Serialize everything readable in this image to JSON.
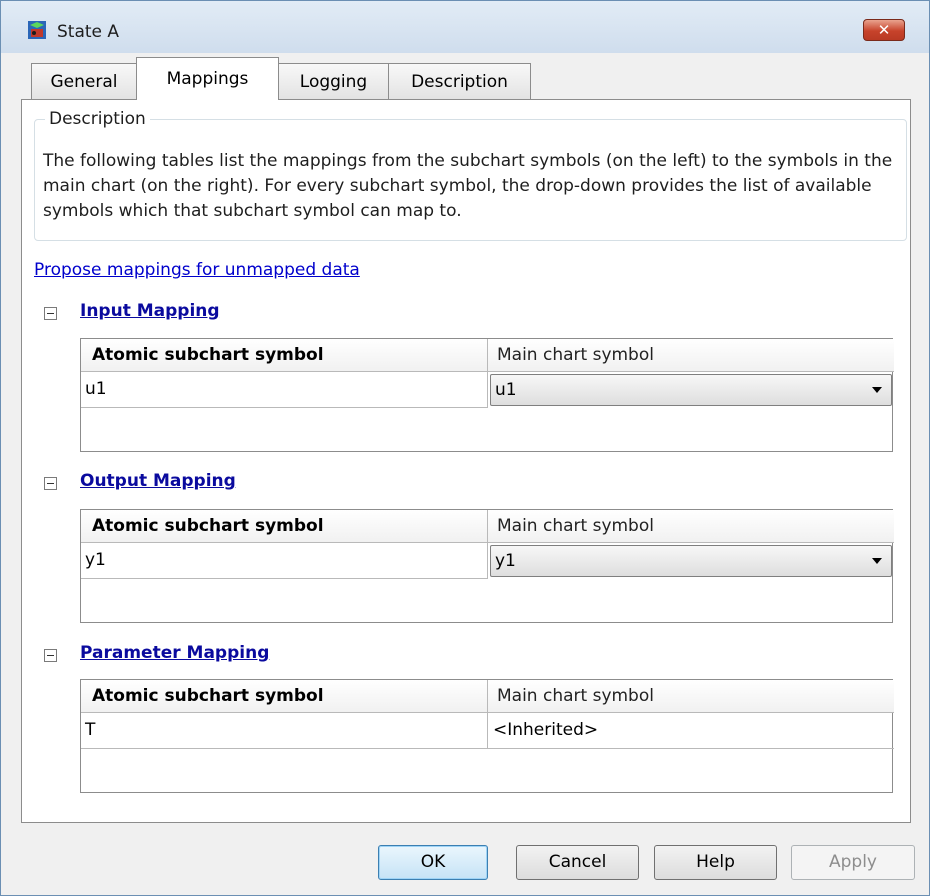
{
  "window": {
    "title": "State A",
    "close_label": "✕"
  },
  "tabs": [
    {
      "label": "General",
      "active": false
    },
    {
      "label": "Mappings",
      "active": true
    },
    {
      "label": "Logging",
      "active": false
    },
    {
      "label": "Description",
      "active": false
    }
  ],
  "description": {
    "legend": "Description",
    "text": "The following tables list the mappings from the subchart symbols (on the left) to the symbols in the main chart (on the right). For every subchart symbol, the drop-down provides the list of available symbols which that subchart symbol can map to."
  },
  "propose_link": "Propose mappings for unmapped data",
  "sections": [
    {
      "title": "Input Mapping",
      "col1_header": "Atomic subchart symbol",
      "col2_header": "Main chart symbol",
      "rows": [
        {
          "symbol": "u1",
          "main": "u1",
          "editable": true
        }
      ]
    },
    {
      "title": "Output Mapping",
      "col1_header": "Atomic subchart symbol",
      "col2_header": "Main chart symbol",
      "rows": [
        {
          "symbol": "y1",
          "main": "y1",
          "editable": true
        }
      ]
    },
    {
      "title": "Parameter Mapping",
      "col1_header": "Atomic subchart symbol",
      "col2_header": "Main chart symbol",
      "rows": [
        {
          "symbol": "T",
          "main": "<Inherited>",
          "editable": false
        }
      ]
    }
  ],
  "buttons": {
    "ok": "OK",
    "cancel": "Cancel",
    "help": "Help",
    "apply": "Apply"
  },
  "icons": {
    "app": "stateflow-state-icon",
    "close": "close-icon",
    "collapse": "collapse-minus-icon",
    "dropdown": "chevron-down-icon"
  },
  "colors": {
    "link": "#0000cc",
    "section_title": "#0a0a9e",
    "close_button": "#c7432b",
    "titlebar": "#dbe6f2"
  }
}
